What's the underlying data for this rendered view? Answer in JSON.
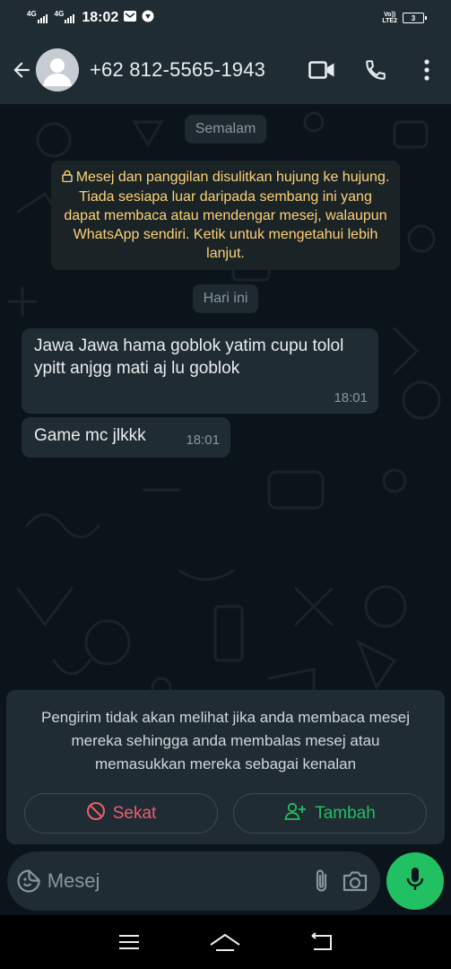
{
  "status_bar": {
    "time": "18:02",
    "network_1": "4G",
    "network_2": "4G",
    "volte_top": "Vo))",
    "volte_bottom": "LTE2",
    "battery": "3"
  },
  "header": {
    "contact_name": "+62 812-5565-1943",
    "icons": [
      "back-arrow-icon",
      "avatar",
      "video-call-icon",
      "voice-call-icon",
      "more-options-icon"
    ]
  },
  "chat": {
    "date_yesterday": "Semalam",
    "encryption_notice": "Mesej dan panggilan disulitkan hujung ke hujung. Tiada sesiapa luar daripada sembang ini yang dapat membaca atau mendengar mesej, walaupun WhatsApp sendiri. Ketik untuk mengetahui lebih lanjut.",
    "date_today": "Hari ini",
    "messages": [
      {
        "text": "Jawa Jawa hama goblok yatim cupu tolol ypitt anjgg mati aj lu goblok",
        "time": "18:01"
      },
      {
        "text": "Game mc jlkkk",
        "time": "18:01"
      }
    ]
  },
  "unknown_sender": {
    "notice": "Pengirim tidak akan melihat jika anda membaca mesej mereka sehingga anda membalas mesej atau memasukkan mereka sebagai kenalan",
    "block_label": "Sekat",
    "add_label": "Tambah"
  },
  "composer": {
    "placeholder": "Mesej"
  },
  "colors": {
    "accent_green": "#21c063",
    "danger_red": "#f15c6d",
    "notice_yellow": "#ffd279",
    "background": "#0b141a",
    "surface": "#1f2c33"
  }
}
